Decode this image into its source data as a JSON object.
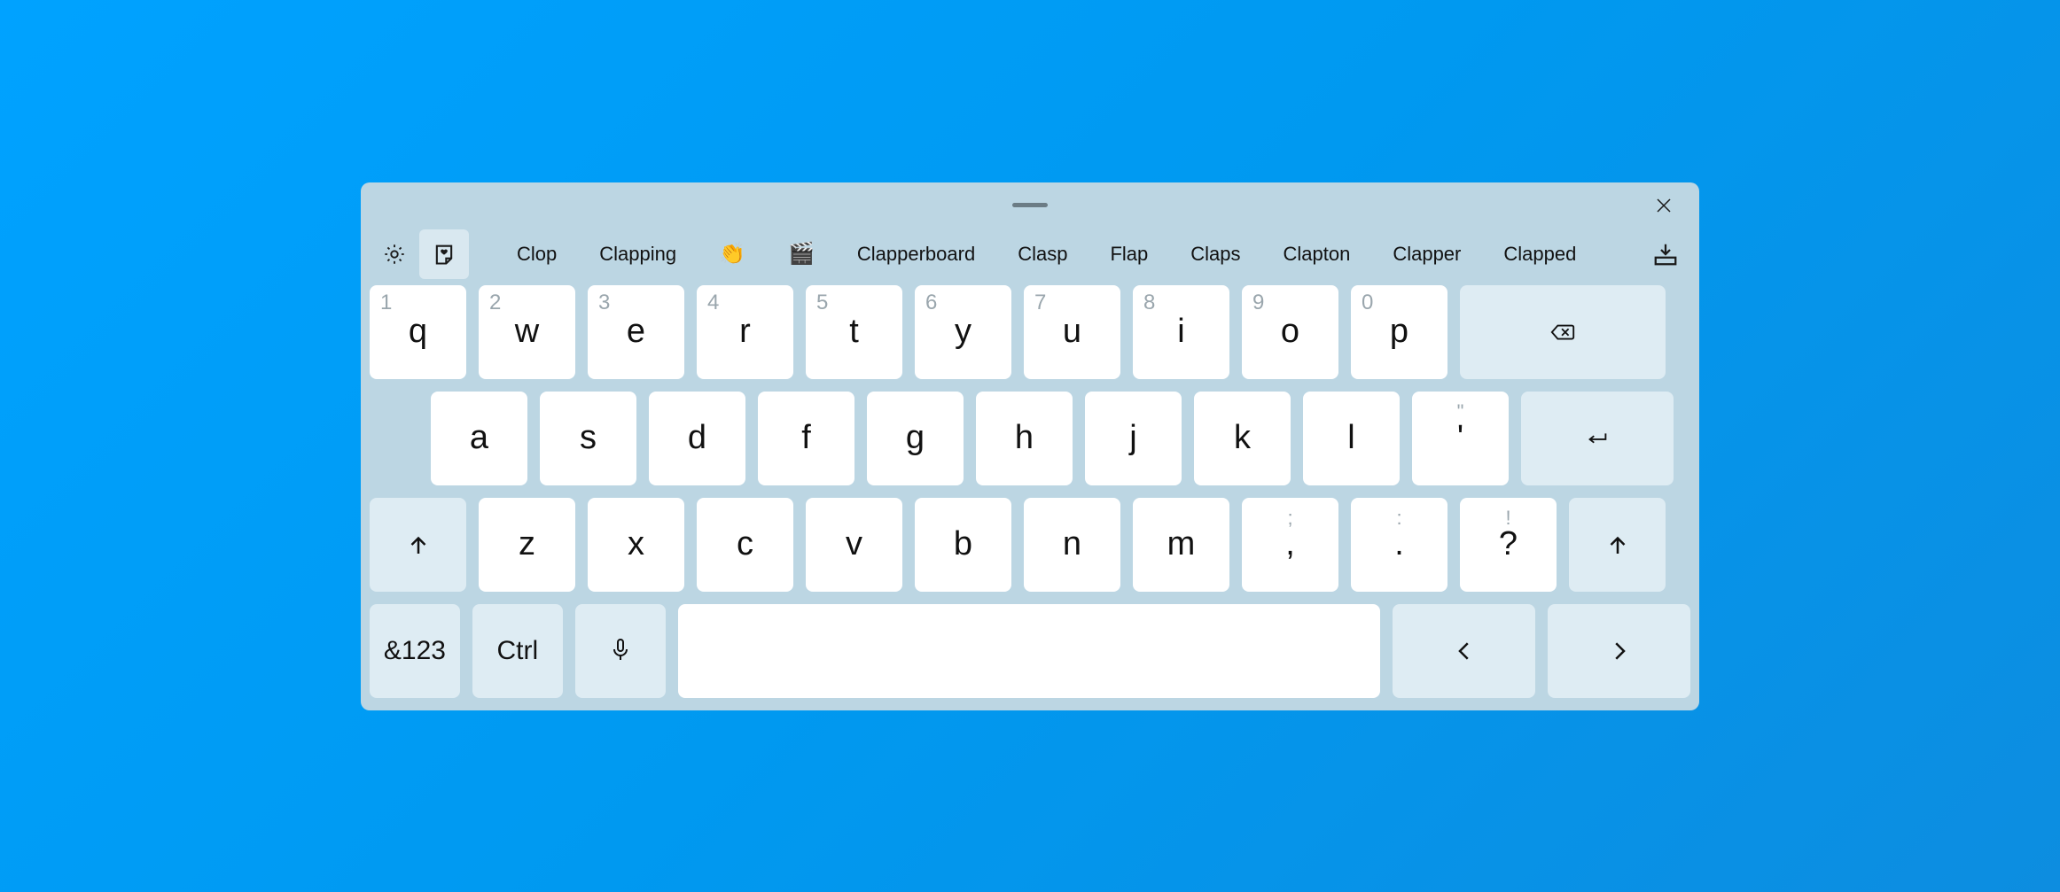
{
  "suggestions": [
    {
      "type": "text",
      "value": "Clop"
    },
    {
      "type": "text",
      "value": "Clapping"
    },
    {
      "type": "emoji",
      "value": "👏"
    },
    {
      "type": "emoji",
      "value": "🎬"
    },
    {
      "type": "text",
      "value": "Clapperboard"
    },
    {
      "type": "text",
      "value": "Clasp"
    },
    {
      "type": "text",
      "value": "Flap"
    },
    {
      "type": "text",
      "value": "Claps"
    },
    {
      "type": "text",
      "value": "Clapton"
    },
    {
      "type": "text",
      "value": "Clapper"
    },
    {
      "type": "text",
      "value": "Clapped"
    }
  ],
  "rows": {
    "r1": [
      {
        "hint": "1",
        "label": "q"
      },
      {
        "hint": "2",
        "label": "w"
      },
      {
        "hint": "3",
        "label": "e"
      },
      {
        "hint": "4",
        "label": "r"
      },
      {
        "hint": "5",
        "label": "t"
      },
      {
        "hint": "6",
        "label": "y"
      },
      {
        "hint": "7",
        "label": "u"
      },
      {
        "hint": "8",
        "label": "i"
      },
      {
        "hint": "9",
        "label": "o"
      },
      {
        "hint": "0",
        "label": "p"
      }
    ],
    "r2": [
      {
        "label": "a"
      },
      {
        "label": "s"
      },
      {
        "label": "d"
      },
      {
        "label": "f"
      },
      {
        "label": "g"
      },
      {
        "label": "h"
      },
      {
        "label": "j"
      },
      {
        "label": "k"
      },
      {
        "label": "l"
      },
      {
        "hint": "\"",
        "label": "'"
      }
    ],
    "r3": [
      {
        "label": "z"
      },
      {
        "label": "x"
      },
      {
        "label": "c"
      },
      {
        "label": "v"
      },
      {
        "label": "b"
      },
      {
        "label": "n"
      },
      {
        "label": "m"
      },
      {
        "hint": ";",
        "label": ","
      },
      {
        "hint": ":",
        "label": "."
      },
      {
        "hint": "!",
        "label": "?"
      }
    ]
  },
  "fn": {
    "symbols": "&123",
    "ctrl": "Ctrl"
  }
}
